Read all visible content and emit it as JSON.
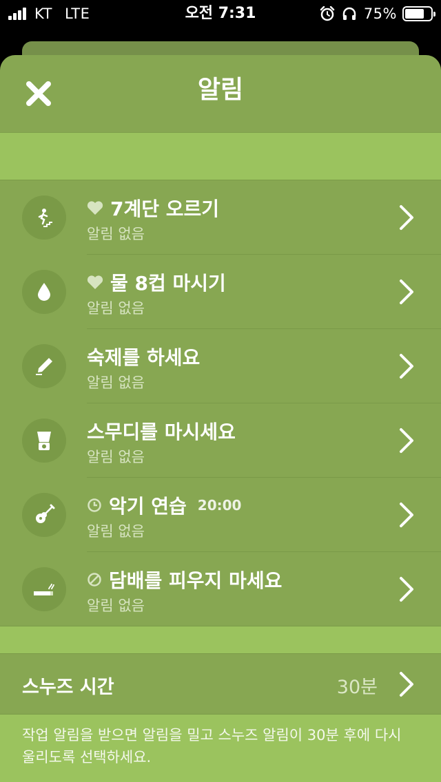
{
  "status_bar": {
    "carrier": "KT",
    "network": "LTE",
    "time": "오전 7:31",
    "battery": "75%",
    "battery_level": 0.75
  },
  "header": {
    "title": "알림",
    "close_icon": "close-icon"
  },
  "habits": [
    {
      "title": "7계단 오르기",
      "subtitle": "알림 없음",
      "prefix_icon": "heart-icon",
      "icon": "stairs-icon",
      "time": ""
    },
    {
      "title": "물 8컵 마시기",
      "subtitle": "알림 없음",
      "prefix_icon": "heart-icon",
      "icon": "water-drop-icon",
      "time": ""
    },
    {
      "title": "숙제를 하세요",
      "subtitle": "알림 없음",
      "prefix_icon": "",
      "icon": "pencil-icon",
      "time": ""
    },
    {
      "title": "스무디를 마시세요",
      "subtitle": "알림 없음",
      "prefix_icon": "",
      "icon": "blender-icon",
      "time": ""
    },
    {
      "title": "악기 연습",
      "subtitle": "알림 없음",
      "prefix_icon": "clock-icon",
      "icon": "guitar-icon",
      "time": "20:00"
    },
    {
      "title": "담배를 피우지 마세요",
      "subtitle": "알림 없음",
      "prefix_icon": "prohibited-icon",
      "icon": "cigarette-icon",
      "time": ""
    }
  ],
  "snooze": {
    "label": "스누즈 시간",
    "value": "30분"
  },
  "footer": {
    "description": "작업 알림을 받으면 알림을 밀고 스누즈 알림이 30분 후에 다시 울리도록 선택하세요."
  },
  "colors": {
    "sheet": "#87a752",
    "band": "#9bc35e",
    "icon_circle": "#7a9a47"
  }
}
